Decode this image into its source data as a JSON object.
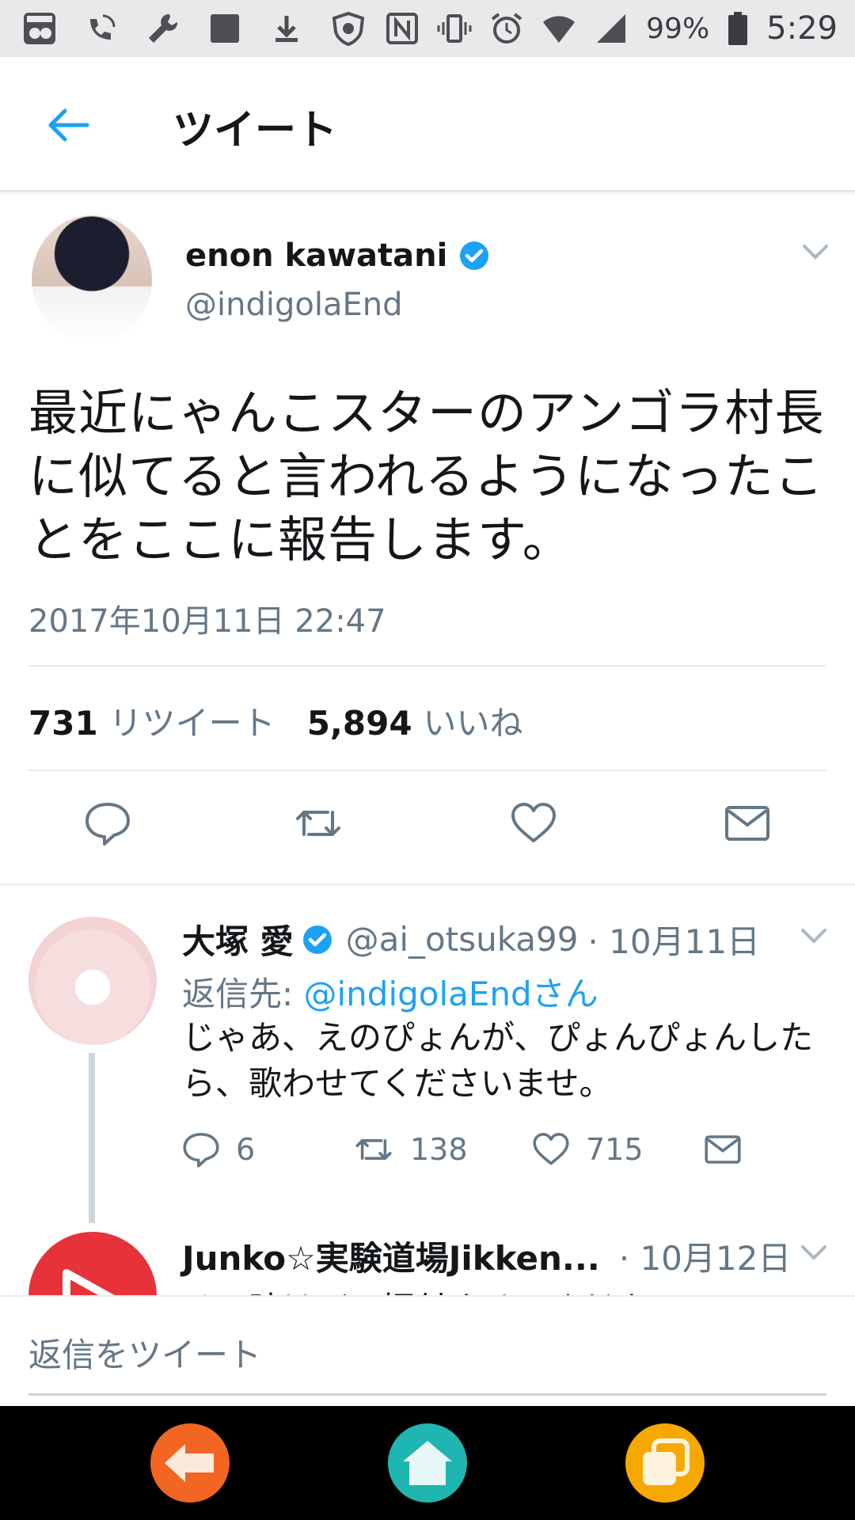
{
  "status_bar": {
    "battery": "99%",
    "time": "5:29",
    "left_icons": [
      "app-badge-icon",
      "wifi-calling-icon",
      "wrench-icon",
      "square-icon",
      "download-icon",
      "shield-icon"
    ],
    "right_icons": [
      "nfc-icon",
      "vibrate-icon",
      "alarm-icon",
      "wifi-icon",
      "signal-icon",
      "battery-icon"
    ]
  },
  "header": {
    "title": "ツイート"
  },
  "tweet": {
    "display_name": "enon kawatani",
    "handle": "@indigolaEnd",
    "verified": true,
    "text": "最近にゃんこスターのアンゴラ村長に似てると言われるようになったことをここに報告します。",
    "timestamp": "2017年10月11日 22:47",
    "retweet_count": "731",
    "retweet_label": "リツイート",
    "like_count": "5,894",
    "like_label": "いいね"
  },
  "replies": [
    {
      "display_name": "大塚 愛",
      "verified": true,
      "handle": "@ai_otsuka99",
      "date": "· 10月11日",
      "reply_to_prefix": "返信先: ",
      "reply_to_link": "@indigolaEndさん",
      "text": "じゃあ、えのぴょんが、ぴょんぴょんしたら、歌わせてくださいませ。",
      "reply_count": "6",
      "retweet_count": "138",
      "like_count": "715"
    },
    {
      "display_name": "Junko☆実験道場Jikken...",
      "date": "· 10月12日",
      "text": "その時はぜひ振付させてください"
    }
  ],
  "compose": {
    "placeholder": "返信をツイート"
  },
  "colors": {
    "accent": "#1da1f2",
    "muted": "#657786",
    "nav_back": "#f26522",
    "nav_home": "#1fb5b0",
    "nav_recent": "#f6a800"
  }
}
